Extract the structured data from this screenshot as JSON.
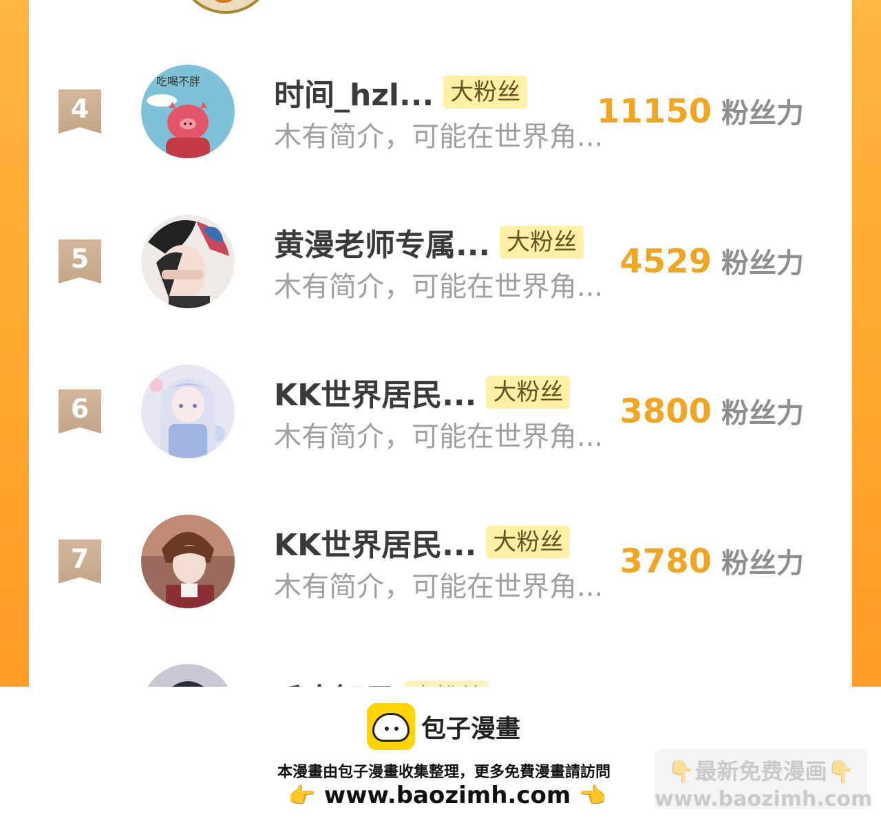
{
  "ranking": {
    "unit_label": "粉丝力",
    "rows": [
      {
        "rank": "4",
        "name": "时间_hzl...",
        "badge": "大粉丝",
        "intro": "木有简介，可能在世界角...",
        "score": "11150"
      },
      {
        "rank": "5",
        "name": "黄漫老师专属...",
        "badge": "大粉丝",
        "intro": "木有简介，可能在世界角...",
        "score": "4529"
      },
      {
        "rank": "6",
        "name": "KK世界居民...",
        "badge": "大粉丝",
        "intro": "木有简介，可能在世界角...",
        "score": "3800"
      },
      {
        "rank": "7",
        "name": "KK世界居民...",
        "badge": "大粉丝",
        "intro": "木有简介，可能在世界角...",
        "score": "3780"
      }
    ],
    "partial_row": {
      "name": "千本智子",
      "badge": "大粉丝"
    }
  },
  "footer": {
    "logo_text": "包子漫畫",
    "note": "本漫畫由包子漫畫收集整理，更多免費漫畫請訪問",
    "hand_left": "👉",
    "url": "www.baozimh.com",
    "hand_right": "👈",
    "watermark_line1": "👇最新免费漫画👇",
    "watermark_line2": "www.baozimh.com"
  }
}
